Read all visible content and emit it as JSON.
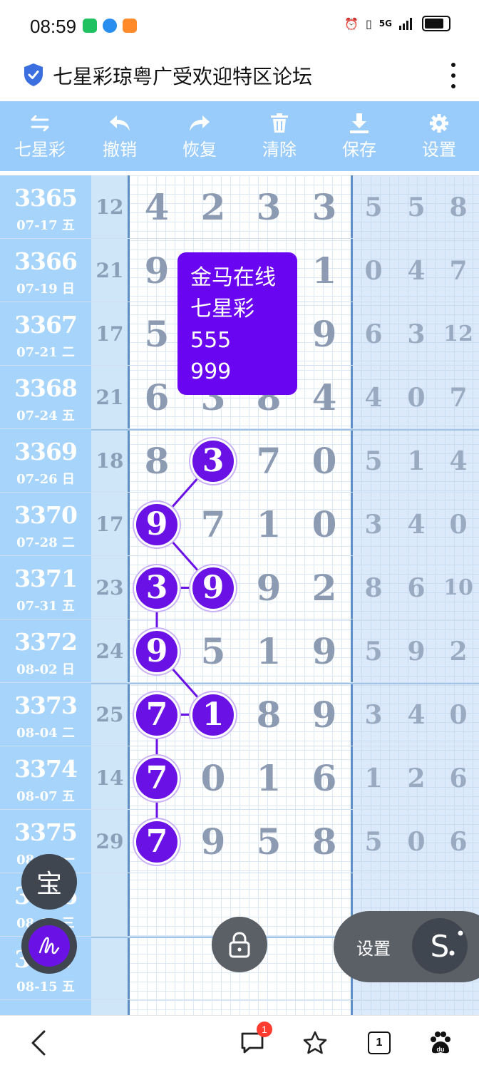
{
  "status_bar": {
    "time": "08:59",
    "network": "5G"
  },
  "page": {
    "title": "七星彩琼粤广受欢迎特区论坛"
  },
  "toolbar": {
    "items": [
      {
        "label": "七星彩",
        "icon": "swap-icon"
      },
      {
        "label": "撤销",
        "icon": "undo-icon"
      },
      {
        "label": "恢复",
        "icon": "redo-icon"
      },
      {
        "label": "清除",
        "icon": "trash-icon"
      },
      {
        "label": "保存",
        "icon": "download-icon"
      },
      {
        "label": "设置",
        "icon": "gear-icon"
      }
    ]
  },
  "rows": [
    {
      "period": "3365",
      "date": "07-17 五",
      "sum": "12",
      "main": [
        "4",
        "2",
        "3",
        "3"
      ],
      "side": [
        "5",
        "5",
        "8"
      ],
      "marked": []
    },
    {
      "period": "3366",
      "date": "07-19 日",
      "sum": "21",
      "main": [
        "9",
        "",
        "",
        "1"
      ],
      "side": [
        "0",
        "4",
        "7"
      ],
      "marked": []
    },
    {
      "period": "3367",
      "date": "07-21 二",
      "sum": "17",
      "main": [
        "5",
        "",
        "",
        "9"
      ],
      "side": [
        "6",
        "3",
        "12"
      ],
      "marked": []
    },
    {
      "period": "3368",
      "date": "07-24 五",
      "sum": "21",
      "main": [
        "6",
        "3",
        "8",
        "4"
      ],
      "side": [
        "4",
        "0",
        "7"
      ],
      "marked": []
    },
    {
      "period": "3369",
      "date": "07-26 日",
      "sum": "18",
      "main": [
        "8",
        "3",
        "7",
        "0"
      ],
      "side": [
        "5",
        "1",
        "4"
      ],
      "marked": [
        1
      ]
    },
    {
      "period": "3370",
      "date": "07-28 二",
      "sum": "17",
      "main": [
        "9",
        "7",
        "1",
        "0"
      ],
      "side": [
        "3",
        "4",
        "0"
      ],
      "marked": [
        0
      ]
    },
    {
      "period": "3371",
      "date": "07-31 五",
      "sum": "23",
      "main": [
        "3",
        "9",
        "9",
        "2"
      ],
      "side": [
        "8",
        "6",
        "10"
      ],
      "marked": [
        0,
        1
      ]
    },
    {
      "period": "3372",
      "date": "08-02 日",
      "sum": "24",
      "main": [
        "9",
        "5",
        "1",
        "9"
      ],
      "side": [
        "5",
        "9",
        "2"
      ],
      "marked": [
        0
      ]
    },
    {
      "period": "3373",
      "date": "08-04 二",
      "sum": "25",
      "main": [
        "7",
        "1",
        "8",
        "9"
      ],
      "side": [
        "3",
        "4",
        "0"
      ],
      "marked": [
        0,
        1
      ]
    },
    {
      "period": "3374",
      "date": "08-07 五",
      "sum": "14",
      "main": [
        "7",
        "0",
        "1",
        "6"
      ],
      "side": [
        "1",
        "2",
        "6"
      ],
      "marked": [
        0
      ]
    },
    {
      "period": "3375",
      "date": "08-10 一",
      "sum": "29",
      "main": [
        "7",
        "9",
        "5",
        "8"
      ],
      "side": [
        "5",
        "0",
        "6"
      ],
      "marked": [
        0
      ]
    },
    {
      "period": "3376",
      "date": "08-12 三",
      "sum": "",
      "main": [
        "",
        "",
        "",
        ""
      ],
      "side": [
        "",
        "",
        ""
      ],
      "marked": []
    },
    {
      "period": "3377",
      "date": "08-15 五",
      "sum": "",
      "main": [
        "",
        "",
        "",
        ""
      ],
      "side": [
        "",
        "",
        ""
      ],
      "marked": []
    }
  ],
  "popup": {
    "lines": [
      "金马在线",
      "七星彩",
      "555",
      "999"
    ]
  },
  "floating": {
    "bao_label": "宝",
    "settings_label": "设置",
    "s_label": "S"
  },
  "bottom_nav": {
    "message_badge": "1",
    "tab_count": "1"
  },
  "colors": {
    "accent": "#6a12e6",
    "toolbar": "#99ccfb",
    "period_col": "#a7d4fb"
  }
}
